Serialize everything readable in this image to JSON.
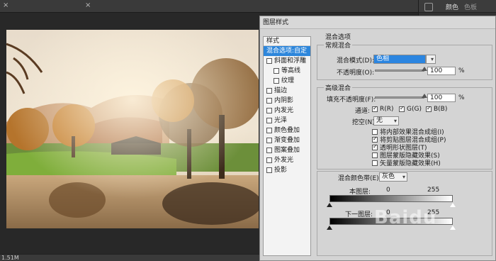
{
  "status": {
    "size_text": "1.51M"
  },
  "right_panel": {
    "tabs": [
      "颜色",
      "色板"
    ]
  },
  "dialog": {
    "title": "图层样式",
    "styles_header": "样式",
    "styles": [
      {
        "label": "混合选项:自定",
        "checkbox": false,
        "active": true,
        "indent": false
      },
      {
        "label": "斜面和浮雕",
        "checkbox": true,
        "checked": false,
        "indent": false
      },
      {
        "label": "等高线",
        "checkbox": true,
        "checked": false,
        "indent": true
      },
      {
        "label": "纹理",
        "checkbox": true,
        "checked": false,
        "indent": true
      },
      {
        "label": "描边",
        "checkbox": true,
        "checked": false,
        "indent": false
      },
      {
        "label": "内阴影",
        "checkbox": true,
        "checked": false,
        "indent": false
      },
      {
        "label": "内发光",
        "checkbox": true,
        "checked": false,
        "indent": false
      },
      {
        "label": "光泽",
        "checkbox": true,
        "checked": false,
        "indent": false
      },
      {
        "label": "颜色叠加",
        "checkbox": true,
        "checked": false,
        "indent": false
      },
      {
        "label": "渐变叠加",
        "checkbox": true,
        "checked": false,
        "indent": false
      },
      {
        "label": "图案叠加",
        "checkbox": true,
        "checked": false,
        "indent": false
      },
      {
        "label": "外发光",
        "checkbox": true,
        "checked": false,
        "indent": false
      },
      {
        "label": "投影",
        "checkbox": true,
        "checked": false,
        "indent": false
      }
    ],
    "blend_options": {
      "section_title": "混合选项",
      "general": {
        "title": "常规混合",
        "blend_mode_label": "混合模式(D):",
        "blend_mode_value": "色相",
        "opacity_label": "不透明度(O):",
        "opacity_value": "100",
        "opacity_unit": "%",
        "opacity_fraction": 1.0
      },
      "advanced": {
        "title": "高级混合",
        "fill_opacity_label": "填充不透明度(F):",
        "fill_opacity_value": "100",
        "fill_opacity_unit": "%",
        "fill_opacity_fraction": 1.0,
        "channels_label": "通道:",
        "channel_r": "R(R)",
        "channel_g": "G(G)",
        "channel_b": "B(B)",
        "knockout_label": "挖空(N):",
        "knockout_value": "无",
        "options": [
          {
            "label": "将内部效果混合成组(I)",
            "checked": false
          },
          {
            "label": "将剪贴图层混合成组(P)",
            "checked": true
          },
          {
            "label": "透明形状图层(T)",
            "checked": true
          },
          {
            "label": "图层蒙版隐藏效果(S)",
            "checked": false
          },
          {
            "label": "矢量蒙版隐藏效果(H)",
            "checked": false
          }
        ]
      },
      "blend_if": {
        "label": "混合颜色带(E):",
        "value": "灰色",
        "this_layer_label": "本图层:",
        "this_layer_min": "0",
        "this_layer_max": "255",
        "under_layer_label": "下一图层:",
        "under_layer_min": "0",
        "under_layer_max": "255"
      }
    }
  },
  "watermark": "Baidu"
}
